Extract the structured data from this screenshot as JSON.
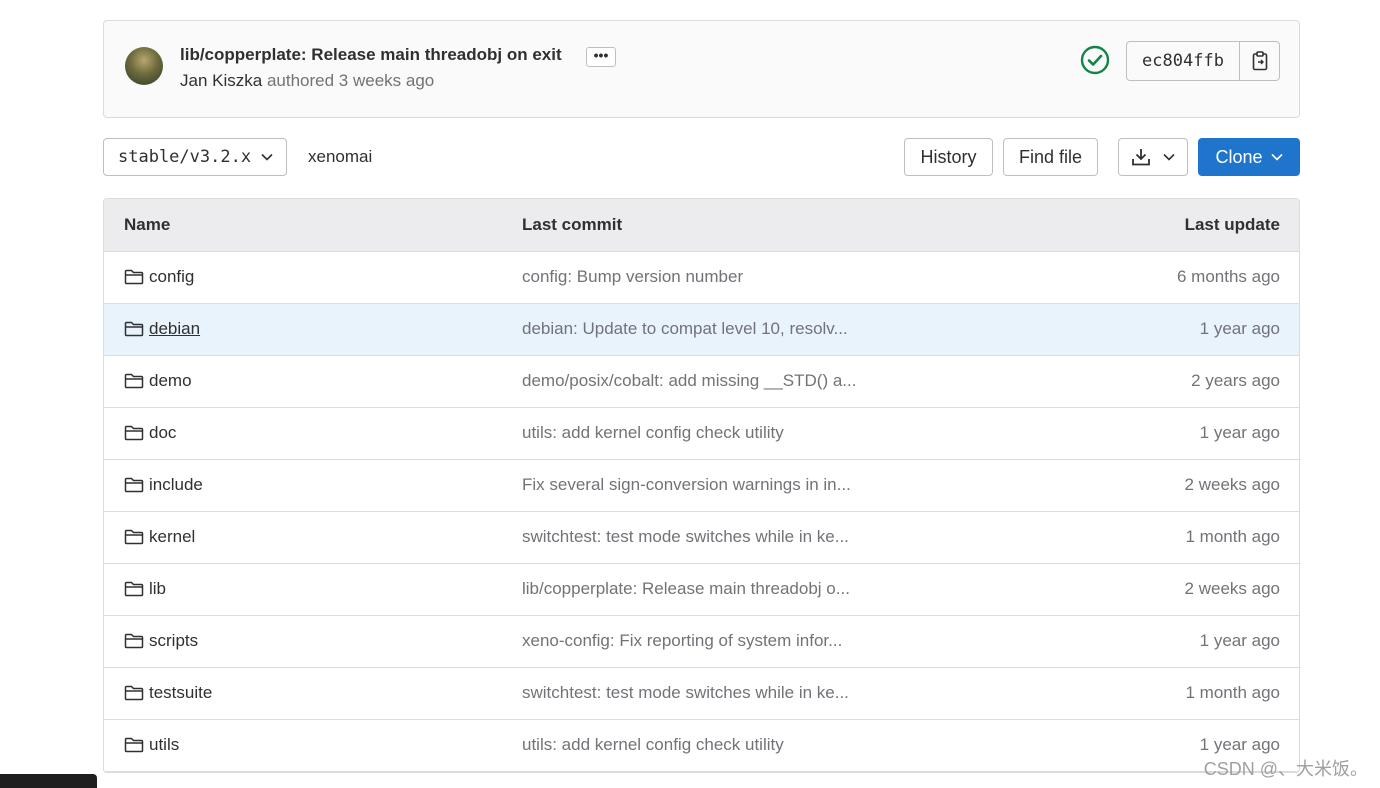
{
  "commit": {
    "title": "lib/copperplate: Release main threadobj on exit",
    "ellipsis": "•••",
    "author": "Jan Kiszka",
    "authored_text": "authored",
    "time": "3 weeks ago",
    "sha": "ec804ffb",
    "status_color": "#108548"
  },
  "toolbar": {
    "branch": "stable/v3.2.x",
    "breadcrumb": "xenomai",
    "history_label": "History",
    "find_file_label": "Find file",
    "clone_label": "Clone",
    "accent": "#1f75cb"
  },
  "table": {
    "headers": {
      "name": "Name",
      "commit": "Last commit",
      "update": "Last update"
    },
    "rows": [
      {
        "name": "config",
        "commit": "config: Bump version number",
        "update": "6 months ago"
      },
      {
        "name": "debian",
        "commit": "debian: Update to compat level 10, resolv...",
        "update": "1 year ago"
      },
      {
        "name": "demo",
        "commit": "demo/posix/cobalt: add missing __STD() a...",
        "update": "2 years ago"
      },
      {
        "name": "doc",
        "commit": "utils: add kernel config check utility",
        "update": "1 year ago"
      },
      {
        "name": "include",
        "commit": "Fix several sign-conversion warnings in in...",
        "update": "2 weeks ago"
      },
      {
        "name": "kernel",
        "commit": "switchtest: test mode switches while in ke...",
        "update": "1 month ago"
      },
      {
        "name": "lib",
        "commit": "lib/copperplate: Release main threadobj o...",
        "update": "2 weeks ago"
      },
      {
        "name": "scripts",
        "commit": "xeno-config: Fix reporting of system infor...",
        "update": "1 year ago"
      },
      {
        "name": "testsuite",
        "commit": "switchtest: test mode switches while in ke...",
        "update": "1 month ago"
      },
      {
        "name": "utils",
        "commit": "utils: add kernel config check utility",
        "update": "1 year ago"
      }
    ]
  },
  "watermark": "CSDN @、大米饭。",
  "icons": [
    "folder-icon",
    "check-circle-icon",
    "copy-icon",
    "chevron-down-icon",
    "download-icon"
  ]
}
